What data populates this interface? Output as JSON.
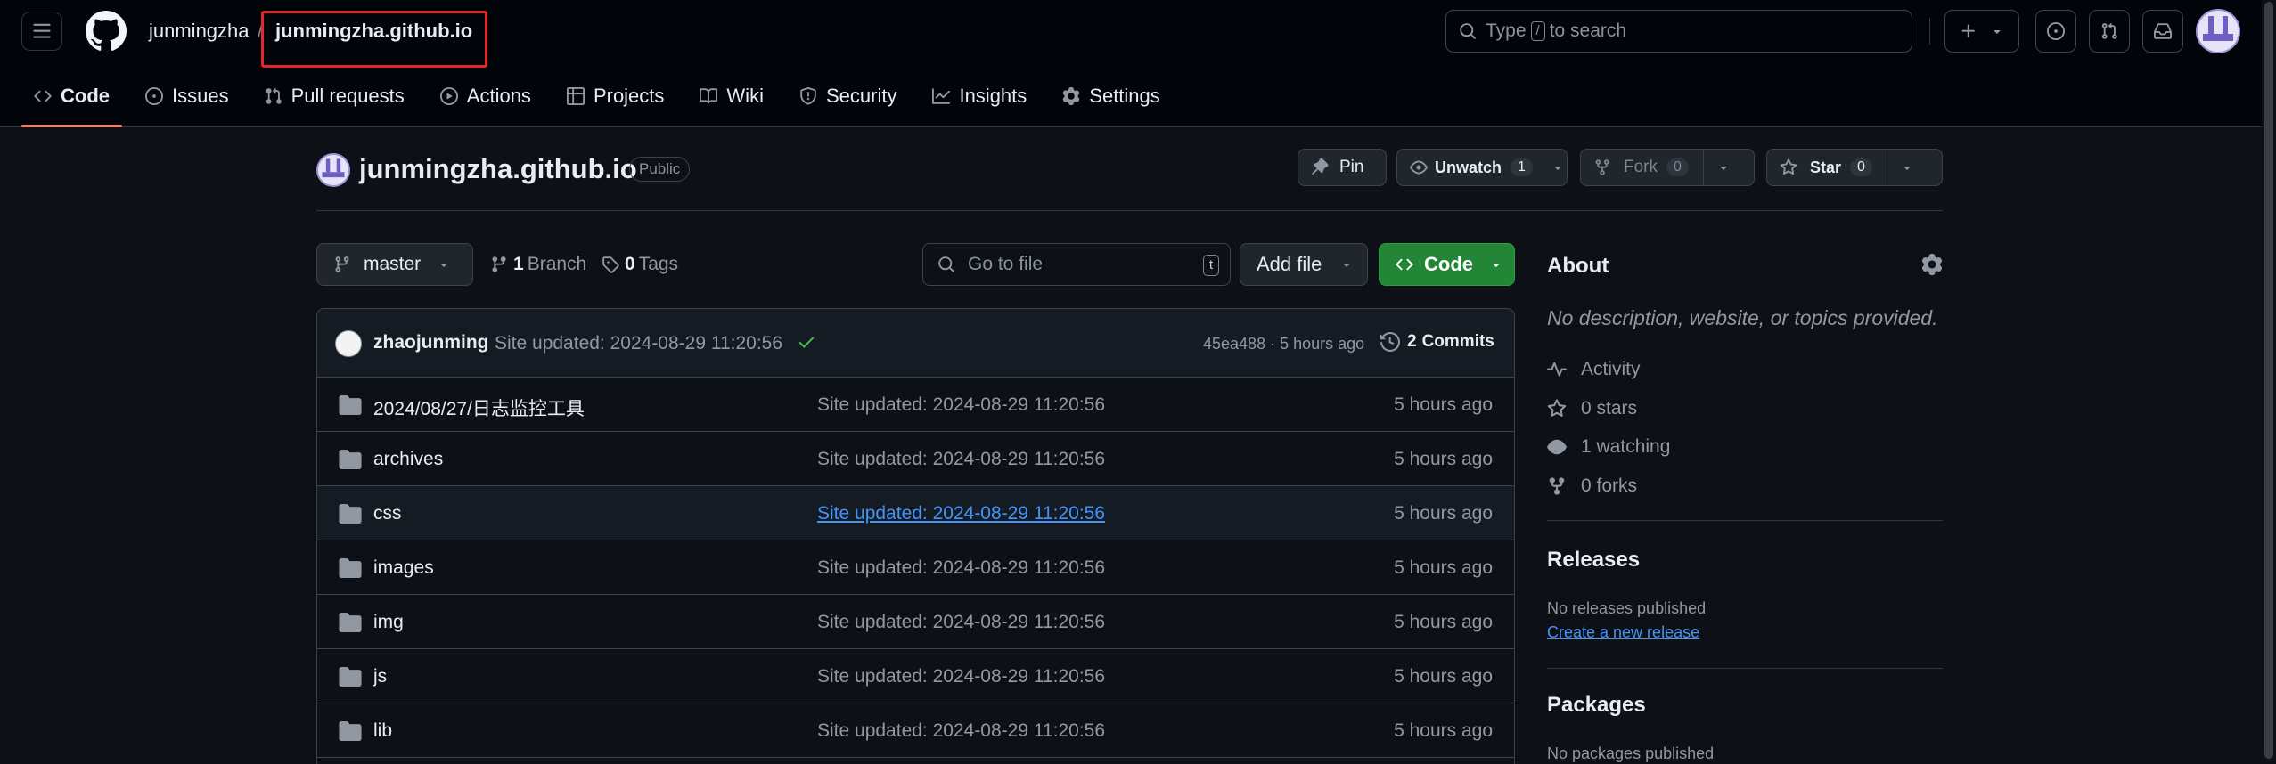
{
  "header": {
    "owner": "junmingzha",
    "separator": "/",
    "repo": "junmingzha.github.io",
    "search_prefix": "Type",
    "search_key": "/",
    "search_suffix": "to search"
  },
  "nav": {
    "tabs": [
      {
        "label": "Code",
        "icon": "code-icon",
        "active": true
      },
      {
        "label": "Issues",
        "icon": "issue-icon"
      },
      {
        "label": "Pull requests",
        "icon": "pull-request-icon"
      },
      {
        "label": "Actions",
        "icon": "play-icon"
      },
      {
        "label": "Projects",
        "icon": "table-icon"
      },
      {
        "label": "Wiki",
        "icon": "book-icon"
      },
      {
        "label": "Security",
        "icon": "shield-icon"
      },
      {
        "label": "Insights",
        "icon": "graph-icon"
      },
      {
        "label": "Settings",
        "icon": "gear-icon"
      }
    ]
  },
  "repo_head": {
    "title": "junmingzha.github.io",
    "visibility": "Public",
    "pin_label": "Pin",
    "unwatch_label": "Unwatch",
    "unwatch_count": "1",
    "fork_label": "Fork",
    "fork_count": "0",
    "star_label": "Star",
    "star_count": "0"
  },
  "file_nav": {
    "branch": "master",
    "branch_count": "1",
    "branch_label": "Branch",
    "tag_count": "0",
    "tag_label": "Tags",
    "goto_placeholder": "Go to file",
    "goto_key": "t",
    "add_file_label": "Add file",
    "code_label": "Code"
  },
  "latest_commit": {
    "user": "zhaojunming",
    "message": "Site updated: 2024-08-29 11:20:56",
    "hash_time": "45ea488 · 5 hours ago",
    "commit_count": "2",
    "commit_label": "Commits"
  },
  "files": [
    {
      "name": "2024/08/27/日志监控工具",
      "message": "Site updated: 2024-08-29 11:20:56",
      "time": "5 hours ago"
    },
    {
      "name": "archives",
      "message": "Site updated: 2024-08-29 11:20:56",
      "time": "5 hours ago"
    },
    {
      "name": "css",
      "message": "Site updated: 2024-08-29 11:20:56",
      "time": "5 hours ago"
    },
    {
      "name": "images",
      "message": "Site updated: 2024-08-29 11:20:56",
      "time": "5 hours ago"
    },
    {
      "name": "img",
      "message": "Site updated: 2024-08-29 11:20:56",
      "time": "5 hours ago"
    },
    {
      "name": "js",
      "message": "Site updated: 2024-08-29 11:20:56",
      "time": "5 hours ago"
    },
    {
      "name": "lib",
      "message": "Site updated: 2024-08-29 11:20:56",
      "time": "5 hours ago"
    }
  ],
  "about": {
    "heading": "About",
    "description": "No description, website, or topics provided.",
    "activity": "Activity",
    "stars": "0 stars",
    "watching": "1 watching",
    "forks": "0 forks"
  },
  "releases": {
    "heading": "Releases",
    "none": "No releases published",
    "create_link": "Create a new release"
  },
  "packages": {
    "heading": "Packages",
    "none": "No packages published"
  },
  "colors": {
    "background": "#0d1117",
    "header_bg": "#010409",
    "accent_tab": "#f78166",
    "primary_button": "#238636",
    "link": "#4493f8",
    "highlight_box": "#e5262a"
  }
}
